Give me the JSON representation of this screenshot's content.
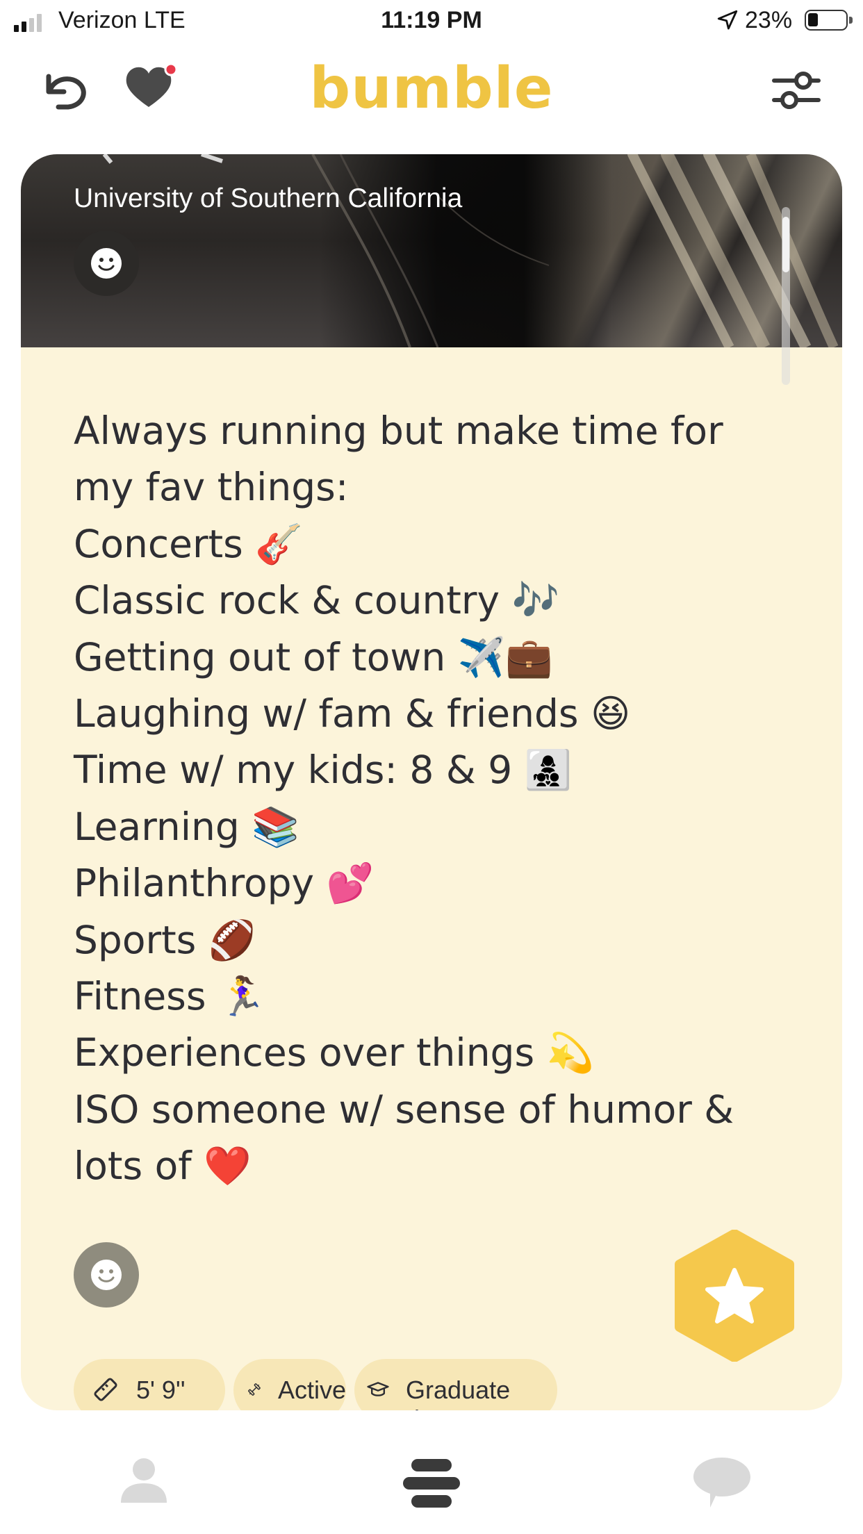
{
  "status_bar": {
    "carrier": "Verizon  LTE",
    "time": "11:19 PM",
    "battery_percent": "23%",
    "signal_bars_filled": 2,
    "signal_bars_total": 4,
    "battery_level": 0.23
  },
  "header": {
    "brand": "bumble",
    "brand_color": "#EFC443",
    "icons": [
      "undo-icon",
      "heart-icon",
      "filters-icon"
    ]
  },
  "profile": {
    "school": "University of Southern California",
    "bio_lines": [
      "Always running but make time for",
      "my fav things:",
      "Concerts 🎸",
      "Classic rock & country 🎶",
      "Getting out of town ✈️💼",
      "Laughing w/ fam & friends 😆",
      "Time w/ my kids: 8 & 9 👩‍👧‍👦",
      "Learning 📚",
      "Philanthropy 💕",
      "Sports 🏈",
      "Fitness 🏃‍♀️",
      "Experiences over things 💫",
      "ISO someone w/ sense of humor &",
      "lots of ❤️"
    ],
    "chips": [
      {
        "icon": "ruler-icon",
        "label": "5' 9''"
      },
      {
        "icon": "dumbbell-icon",
        "label": "Active"
      },
      {
        "icon": "graduation-cap-icon",
        "label": "Graduate degree"
      }
    ]
  },
  "actions": {
    "superswipe_icon": "star-icon",
    "superswipe_color": "#F5C84C"
  },
  "tabbar": {
    "tabs": [
      {
        "icon": "profile-icon"
      },
      {
        "icon": "swipe-stack-icon"
      },
      {
        "icon": "chat-bubble-icon"
      }
    ]
  }
}
